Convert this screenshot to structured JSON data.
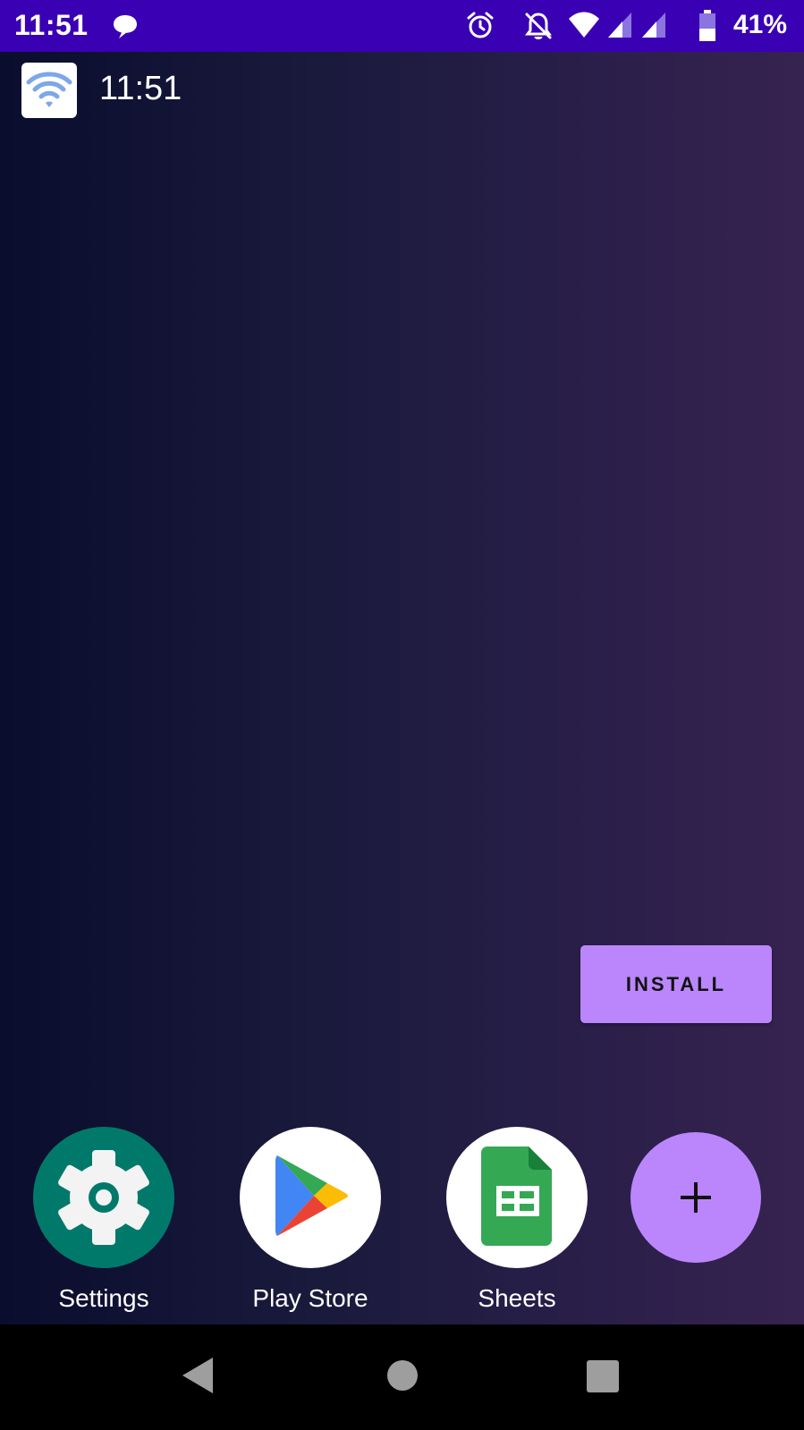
{
  "status_bar": {
    "time": "11:51",
    "battery_percent": "41%",
    "background_color": "#3a00b4",
    "icons": [
      "message-icon",
      "alarm-icon",
      "notifications-off-icon",
      "wifi-icon",
      "cell-signal-icon",
      "cell-signal-icon",
      "battery-icon"
    ]
  },
  "widget": {
    "icon": "wifi-icon",
    "time": "11:51"
  },
  "install_button": {
    "label": "INSTALL",
    "color": "#bb86fc"
  },
  "dock": {
    "apps": [
      {
        "label": "Settings",
        "icon": "settings-gear-icon",
        "color": "#00796b"
      },
      {
        "label": "Play Store",
        "icon": "play-store-icon",
        "color": "#ffffff"
      },
      {
        "label": "Sheets",
        "icon": "sheets-icon",
        "color": "#ffffff"
      }
    ],
    "add_button": {
      "icon": "plus-icon",
      "color": "#bb86fc"
    }
  },
  "nav_bar": {
    "buttons": [
      "back-icon",
      "home-icon",
      "recents-icon"
    ]
  }
}
